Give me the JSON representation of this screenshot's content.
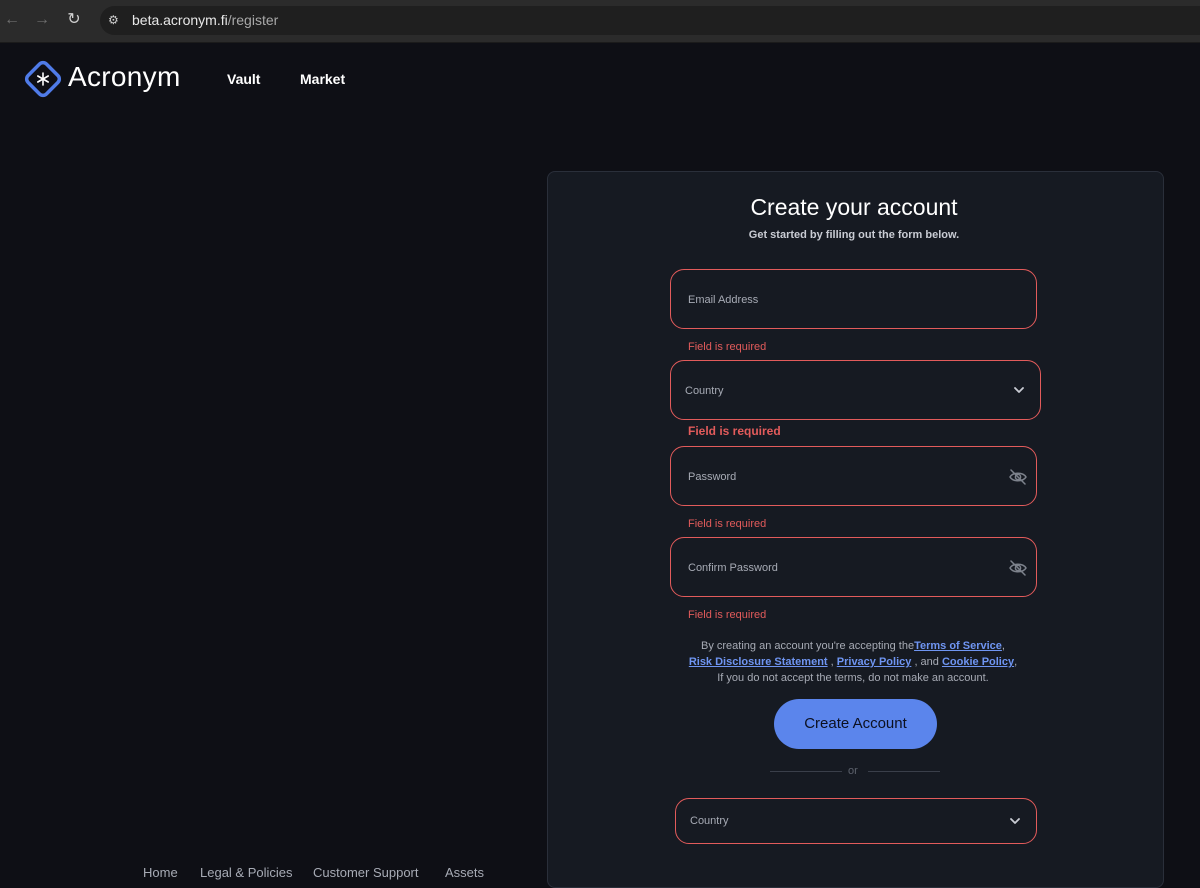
{
  "browser": {
    "url_domain": "beta.acronym.fi",
    "url_path": "/register",
    "back_icon": "←",
    "forward_icon": "→",
    "reload_icon": "↻",
    "site_info_icon": "⚙"
  },
  "header": {
    "logo_text": "Acronym",
    "nav": [
      "Vault",
      "Market"
    ]
  },
  "card": {
    "title": "Create your account",
    "subtitle": "Get started by filling out the form below.",
    "email_placeholder": "Email Address",
    "email_error": "Field is required",
    "country_placeholder": "Country",
    "country_error": "Field is required",
    "password_placeholder": "Password",
    "password_error": "Field is required",
    "confirm_placeholder": "Confirm Password",
    "confirm_error": "Field is required",
    "terms": {
      "prefix": "By creating an account you're accepting the",
      "tos": "Terms of Service",
      "risk": "Risk Disclosure Statement",
      "privacy": "Privacy Policy",
      "and": ", and",
      "cookie": "Cookie Policy",
      "suffix": "If you do not accept the terms, do not make an account."
    },
    "create_button": "Create Account",
    "or_text": "or",
    "country2_placeholder": "Country"
  },
  "footer": {
    "links": [
      "Home",
      "Legal & Policies",
      "Customer Support",
      "Assets"
    ]
  },
  "colors": {
    "accent": "#5b85ec",
    "error": "#e25b5b",
    "background": "#0e0f15"
  }
}
